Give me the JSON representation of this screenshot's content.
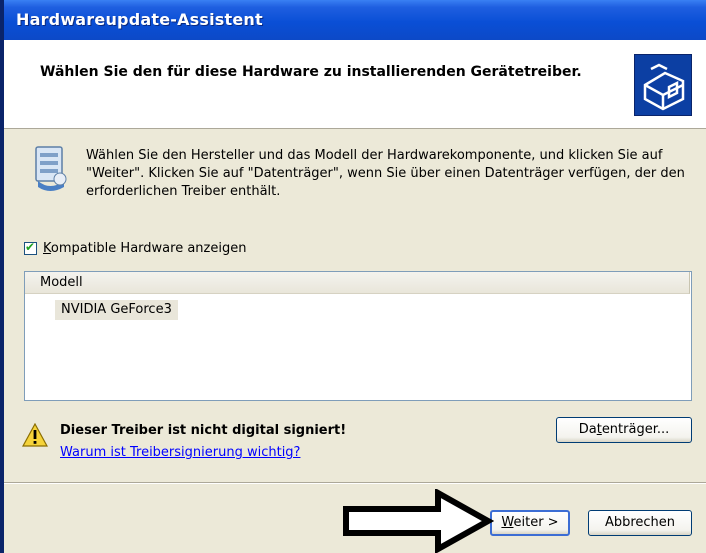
{
  "window": {
    "title": "Hardwareupdate-Assistent"
  },
  "header": {
    "title": "Wählen Sie den für diese Hardware zu installierenden Gerätetreiber."
  },
  "instructions": "Wählen Sie den Hersteller und das Modell der Hardwarekomponente, und klicken Sie auf \"Weiter\". Klicken Sie auf \"Datenträger\", wenn Sie über einen Datenträger verfügen, der den erforderlichen Treiber enthält.",
  "compatible_checkbox": {
    "label_underlined": "K",
    "label_rest": "ompatible Hardware anzeigen",
    "checked": true
  },
  "model_list": {
    "column_header": "Modell",
    "items": [
      "NVIDIA GeForce3"
    ],
    "selected_index": 0
  },
  "warning": {
    "text": "Dieser Treiber ist nicht digital signiert!",
    "link": "Warum ist Treibersignierung wichtig?"
  },
  "buttons": {
    "datentraeger": {
      "pre": "Da",
      "underlined": "t",
      "post": "enträger..."
    },
    "weiter": {
      "underlined": "W",
      "post": "eiter >"
    },
    "abbrechen": "Abbrechen"
  },
  "colors": {
    "titlebar": "#0a4fd6",
    "window_bg": "#ece9d8",
    "link": "#0000ff",
    "checkbox_tick": "#21a121"
  }
}
